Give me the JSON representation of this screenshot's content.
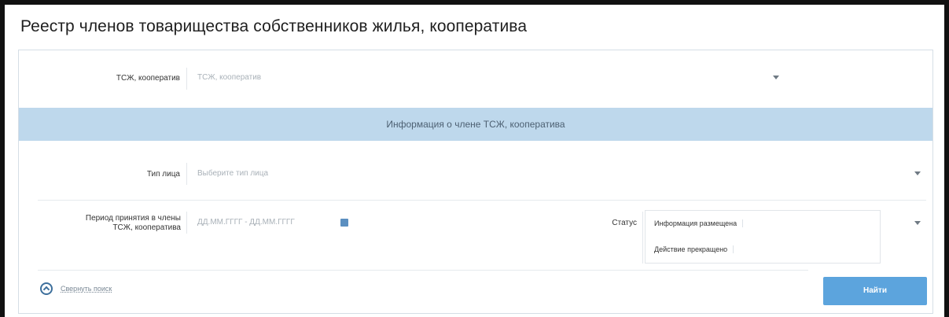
{
  "page": {
    "title": "Реестр членов товарищества собственников жилья, кооператива"
  },
  "form": {
    "tszh": {
      "label": "ТСЖ, кооператив",
      "placeholder": "ТСЖ, кооператив"
    },
    "section_header": "Информация о члене ТСЖ, кооператива",
    "person_type": {
      "label": "Тип лица",
      "placeholder": "Выберите тип лица"
    },
    "period": {
      "label_line1": "Период принятия в члены",
      "label_line2": "ТСЖ, кооператива",
      "placeholder": "ДД.ММ.ГГГГ - ДД.ММ.ГГГГ"
    },
    "status": {
      "label": "Статус",
      "tags": [
        "Информация размещена",
        "Действие прекращено"
      ]
    }
  },
  "footer": {
    "collapse_link": "Свернуть поиск",
    "find_button": "Найти"
  },
  "colors": {
    "section_header_bg": "#bed8ec",
    "primary_button": "#5ca4dd"
  }
}
